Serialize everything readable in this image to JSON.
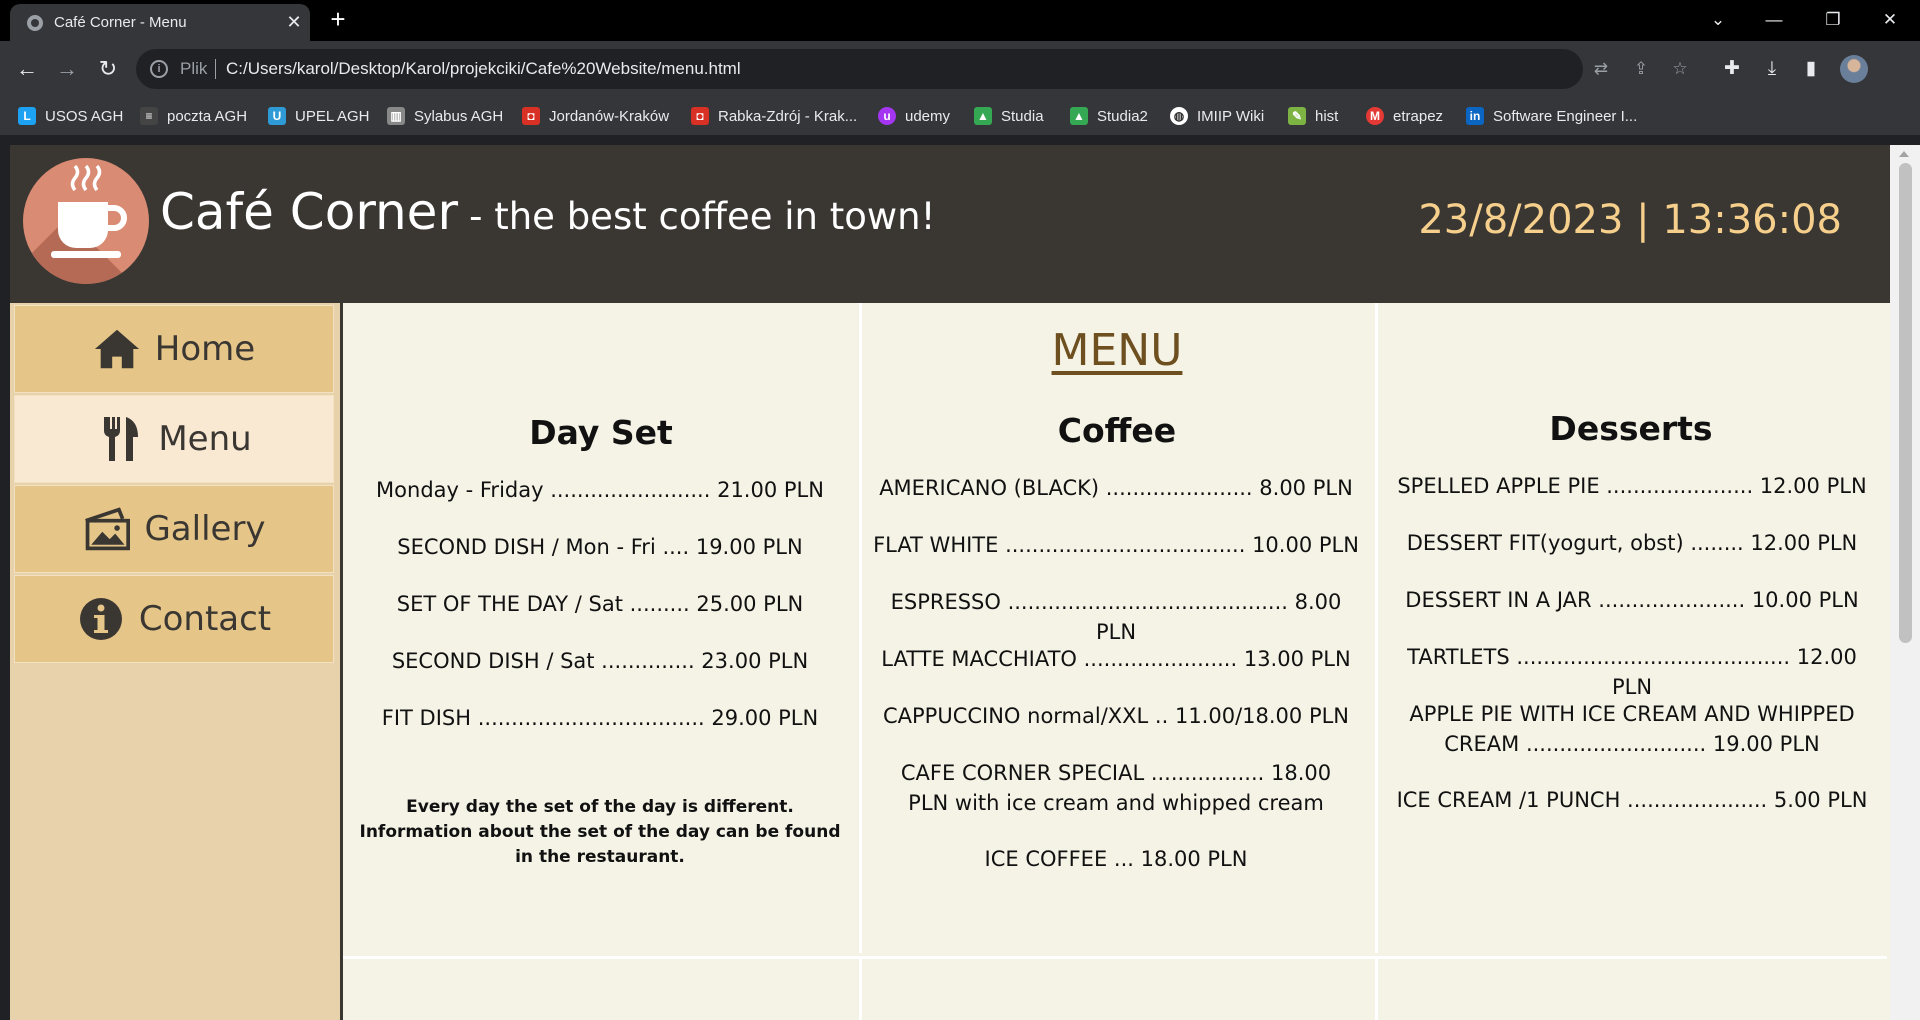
{
  "browser": {
    "tab_title": "Café Corner - Menu",
    "url_scheme_label": "Plik",
    "url": "C:/Users/karol/Desktop/Karol/projekciki/Cafe%20Website/menu.html",
    "bookmarks": [
      {
        "label": "USOS AGH",
        "icon": "usos-icon",
        "color": "#1da1f2"
      },
      {
        "label": "poczta AGH",
        "icon": "mail-icon",
        "color": "#444444"
      },
      {
        "label": "UPEL AGH",
        "icon": "upel-icon",
        "color": "#2e9bd6"
      },
      {
        "label": "Sylabus AGH",
        "icon": "books-icon",
        "color": "#cccccc"
      },
      {
        "label": "Jordanów-Kraków",
        "icon": "bus-icon",
        "color": "#d93025"
      },
      {
        "label": "Rabka-Zdrój - Krak...",
        "icon": "bus-icon",
        "color": "#d93025"
      },
      {
        "label": "udemy",
        "icon": "udemy-icon",
        "color": "#a435f0"
      },
      {
        "label": "Studia",
        "icon": "drive-icon",
        "color": "#34a853"
      },
      {
        "label": "Studia2",
        "icon": "drive-icon",
        "color": "#34a853"
      },
      {
        "label": "IMIIP Wiki",
        "icon": "globe-icon",
        "color": "#ffffff"
      },
      {
        "label": "hist",
        "icon": "document-icon",
        "color": "#7cb342"
      },
      {
        "label": "etrapez",
        "icon": "etrapez-icon",
        "color": "#e53935"
      },
      {
        "label": "Software Engineer I...",
        "icon": "linkedin-icon",
        "color": "#0a66c2"
      }
    ]
  },
  "header": {
    "brand_name": "Café Corner",
    "tagline": "- the best coffee in town!",
    "datetime": "23/8/2023 | 13:36:08"
  },
  "nav": [
    {
      "label": "Home",
      "icon": "home-icon"
    },
    {
      "label": "Menu",
      "icon": "cutlery-icon"
    },
    {
      "label": "Gallery",
      "icon": "gallery-icon"
    },
    {
      "label": "Contact",
      "icon": "info-icon"
    }
  ],
  "menu": {
    "title": "MENU",
    "day_set": {
      "heading": "Day Set",
      "items": [
        "Monday - Friday ........................ 21.00 PLN",
        "SECOND DISH / Mon - Fri .... 19.00 PLN",
        "SET OF THE DAY / Sat ......... 25.00 PLN",
        "SECOND DISH / Sat .............. 23.00 PLN",
        "FIT DISH .................................. 29.00 PLN"
      ],
      "note": "Every day the set of the day is different. Information about the set of the day can be found in the restaurant."
    },
    "coffee": {
      "heading": "Coffee",
      "items": [
        "AMERICANO (BLACK) ...................... 8.00 PLN",
        "FLAT WHITE .................................... 10.00 PLN",
        "ESPRESSO .......................................... 8.00 PLN",
        "LATTE MACCHIATO ....................... 13.00 PLN",
        "CAPPUCCINO normal/XXL .. 11.00/18.00 PLN",
        "CAFE CORNER SPECIAL ................. 18.00 PLN with ice cream and whipped cream",
        "ICE COFFEE ... 18.00 PLN"
      ]
    },
    "desserts": {
      "heading": "Desserts",
      "items": [
        "SPELLED APPLE PIE ...................... 12.00 PLN",
        "DESSERT FIT(yogurt, obst) ........ 12.00 PLN",
        "DESSERT IN A JAR ...................... 10.00 PLN",
        "TARTLETS ......................................... 12.00 PLN",
        "APPLE PIE WITH ICE CREAM AND WHIPPED CREAM ........................... 19.00 PLN",
        "ICE CREAM /1 PUNCH ..................... 5.00 PLN"
      ]
    }
  },
  "colors": {
    "header_bg": "#3a3733",
    "datetime": "#f5cf8b",
    "nav_bg": "#e6c688",
    "nav_active_bg": "#f9e8d2",
    "content_bg": "#f5f3e6",
    "menu_title": "#6e4f1f"
  }
}
